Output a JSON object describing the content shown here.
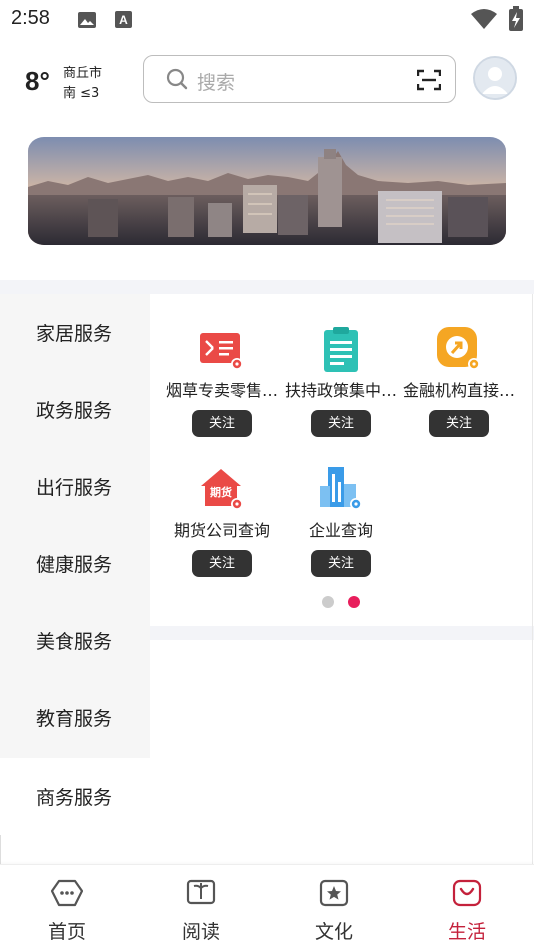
{
  "status_bar": {
    "time": "2:58",
    "icons": [
      "image-icon",
      "a-icon",
      "wifi-icon",
      "battery-icon"
    ]
  },
  "header": {
    "temperature": "8°",
    "city": "商丘市",
    "wind": "南 ≤3",
    "search_placeholder": "搜索"
  },
  "sidebar": {
    "items": [
      {
        "label": "家居服务"
      },
      {
        "label": "政务服务"
      },
      {
        "label": "出行服务"
      },
      {
        "label": "健康服务"
      },
      {
        "label": "美食服务"
      },
      {
        "label": "教育服务"
      },
      {
        "label": "商务服务"
      }
    ],
    "active_index": 6
  },
  "services": [
    {
      "name": "烟草专卖零售许可证查询",
      "display": "烟草专卖零售…",
      "icon": "license-icon",
      "follow": "关注",
      "color": "#ea4a46"
    },
    {
      "name": "扶持政策集中查询",
      "display": "扶持政策集中…",
      "icon": "clipboard-icon",
      "follow": "关注",
      "color": "#2ec1b5"
    },
    {
      "name": "金融机构直接查询",
      "display": "金融机构直接…",
      "icon": "finance-icon",
      "follow": "关注",
      "color": "#f5a623"
    },
    {
      "name": "期货公司查询",
      "display": "期货公司查询",
      "icon": "futures-house-icon",
      "icon_text": "期货",
      "follow": "关注",
      "color": "#ea4a46"
    },
    {
      "name": "企业查询",
      "display": "企业查询",
      "icon": "building-icon",
      "follow": "关注",
      "color": "#3a9be8"
    }
  ],
  "pager": {
    "pages": 2,
    "current": 2,
    "active_color": "#e81e5c",
    "inactive_color": "#cccccc"
  },
  "bottom_nav": {
    "items": [
      {
        "label": "首页",
        "icon": "home-icon"
      },
      {
        "label": "阅读",
        "icon": "book-icon"
      },
      {
        "label": "文化",
        "icon": "culture-star-icon"
      },
      {
        "label": "生活",
        "icon": "shopping-bag-icon"
      }
    ],
    "active_index": 3,
    "active_color": "#c4213b"
  }
}
